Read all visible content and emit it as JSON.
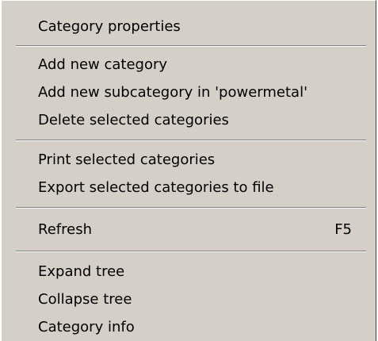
{
  "menu": {
    "groups": [
      {
        "items": [
          {
            "label": "Category properties"
          }
        ]
      },
      {
        "items": [
          {
            "label": "Add new category"
          },
          {
            "label": "Add new subcategory in 'powermetal'"
          },
          {
            "label": "Delete selected categories"
          }
        ]
      },
      {
        "items": [
          {
            "label": "Print selected categories"
          },
          {
            "label": "Export selected categories to file"
          }
        ]
      },
      {
        "items": [
          {
            "label": "Refresh",
            "shortcut": "F5"
          }
        ]
      },
      {
        "items": [
          {
            "label": "Expand tree"
          },
          {
            "label": "Collapse tree"
          },
          {
            "label": "Category info"
          }
        ]
      }
    ]
  }
}
